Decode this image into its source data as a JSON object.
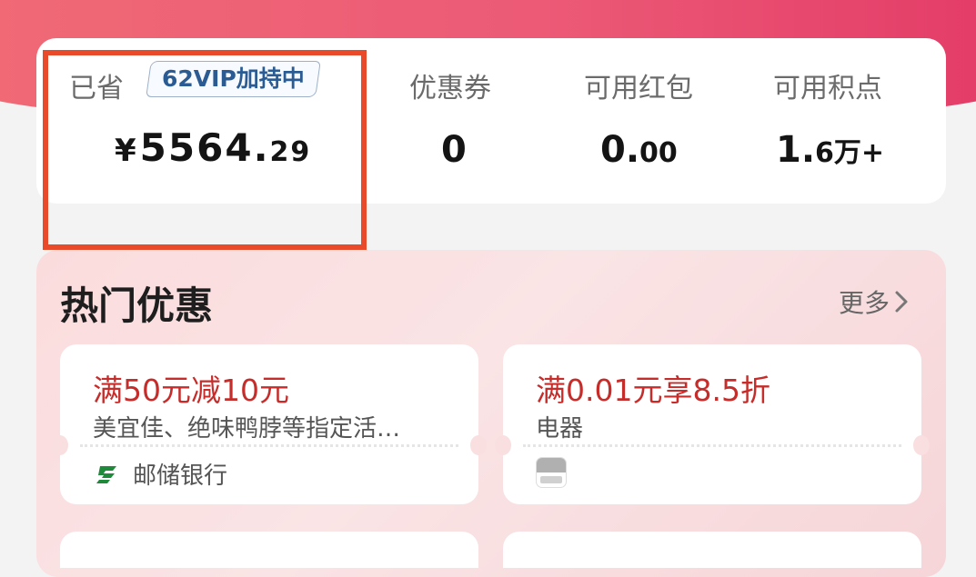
{
  "stats": {
    "saved": {
      "label": "已省",
      "vip_badge": "62VIP加持中",
      "currency": "¥",
      "value_int": "5564.",
      "value_dec": "29"
    },
    "coupons": {
      "label": "优惠券",
      "value": "0"
    },
    "red_packets": {
      "label": "可用红包",
      "value_int": "0.",
      "value_dec": "00"
    },
    "points": {
      "label": "可用积点",
      "value_int": "1.",
      "value_dec": "6万+"
    }
  },
  "hot": {
    "title": "热门优惠",
    "more_label": "更多",
    "offers": [
      {
        "title": "满50元减10元",
        "desc": "美宜佳、绝味鸭脖等指定活…",
        "issuer": "邮储银行",
        "issuer_icon": "psbc-bank-icon"
      },
      {
        "title": "满0.01元享8.5折",
        "desc": "电器",
        "issuer": "",
        "issuer_icon": "chinapay-icon"
      }
    ]
  },
  "colors": {
    "header_gradient_start": "#f06a75",
    "header_gradient_end": "#e33b67",
    "offer_title": "#c62d2a",
    "highlight_box": "#e84a2a",
    "vip_badge_text": "#2a5b92"
  }
}
